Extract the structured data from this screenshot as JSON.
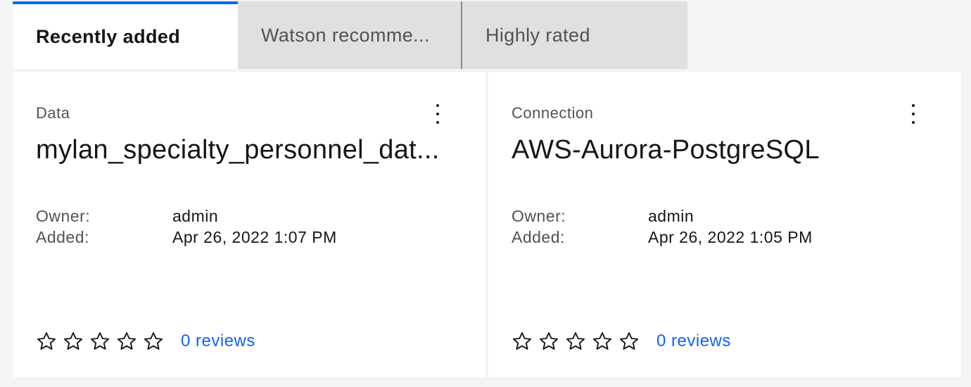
{
  "tabs": [
    {
      "label": "Recently added",
      "active": true
    },
    {
      "label": "Watson recomme...",
      "active": false
    },
    {
      "label": "Highly rated",
      "active": false
    }
  ],
  "cards": [
    {
      "type": "Data",
      "title": "mylan_specialty_personnel_dat...",
      "owner_label": "Owner:",
      "owner": "admin",
      "added_label": "Added:",
      "added": "Apr 26, 2022 1:07 PM",
      "rating": 0,
      "reviews": "0 reviews",
      "menu_icon": "overflow-menu-icon"
    },
    {
      "type": "Connection",
      "title": "AWS-Aurora-PostgreSQL",
      "owner_label": "Owner:",
      "owner": "admin",
      "added_label": "Added:",
      "added": "Apr 26, 2022 1:05 PM",
      "rating": 0,
      "reviews": "0 reviews",
      "menu_icon": "overflow-menu-icon"
    }
  ],
  "colors": {
    "accent": "#0f62fe",
    "background": "#f4f4f4",
    "tab_inactive": "#e0e0e0",
    "card": "#ffffff"
  }
}
